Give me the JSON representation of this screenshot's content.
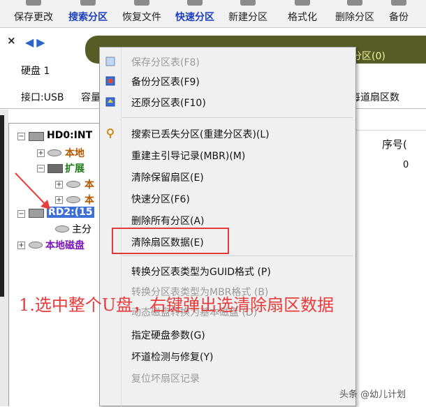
{
  "toolbar": {
    "items": [
      {
        "label": "保存更改",
        "icon": "save-icon"
      },
      {
        "label": "搜索分区",
        "icon": "search-partition-icon"
      },
      {
        "label": "恢复文件",
        "icon": "recover-file-icon"
      },
      {
        "label": "快速分区",
        "icon": "quick-partition-icon"
      },
      {
        "label": "新建分区",
        "icon": "new-partition-icon"
      },
      {
        "label": "格式化",
        "icon": "format-icon"
      },
      {
        "label": "删除分区",
        "icon": "delete-partition-icon"
      },
      {
        "label": "备份",
        "icon": "backup-icon"
      }
    ]
  },
  "info": {
    "close": "×",
    "nav": "◀▶",
    "disk": "硬盘 1",
    "interface": "接口:USB",
    "capacity": "容量",
    "sector_label": "每道扇区数",
    "partition_banner": "主分区(0)"
  },
  "tree": {
    "items": [
      {
        "label": "HD0:INT",
        "color": "#111111"
      },
      {
        "label": "本地",
        "color": "#b35a00"
      },
      {
        "label": "扩展",
        "color": "#1d7a16"
      },
      {
        "label": "本",
        "color": "#b35a00"
      },
      {
        "label": "本",
        "color": "#b35a00"
      },
      {
        "label": "RD2:(15",
        "color": "#ffffff"
      },
      {
        "label": "主分",
        "color": "#111111"
      },
      {
        "label": "本地磁盘",
        "color": "#7a17b8"
      }
    ]
  },
  "right": {
    "seq_header": "序号(",
    "seq_value": "0"
  },
  "menu": {
    "items": [
      {
        "label": "保存分区表(F8)",
        "disabled": true
      },
      {
        "label": "备份分区表(F9)",
        "disabled": false
      },
      {
        "label": "还原分区表(F10)",
        "disabled": false
      },
      {
        "label": "搜索已丢失分区(重建分区表)(L)",
        "disabled": false
      },
      {
        "label": "重建主引导记录(MBR)(M)",
        "disabled": false
      },
      {
        "label": "清除保留扇区(E)",
        "disabled": false
      },
      {
        "label": "快速分区(F6)",
        "disabled": false
      },
      {
        "label": "删除所有分区(A)",
        "disabled": false
      },
      {
        "label": "清除扇区数据(E)",
        "disabled": false
      },
      {
        "label": "转换分区表类型为GUID格式 (P)",
        "disabled": false
      },
      {
        "label": "转换分区表类型为MBR格式 (B)",
        "disabled": true
      },
      {
        "label": "动态磁盘转换为基本磁盘 (D)",
        "disabled": true
      },
      {
        "label": "指定硬盘参数(G)",
        "disabled": false
      },
      {
        "label": "坏道检测与修复(Y)",
        "disabled": false
      },
      {
        "label": "复位坏扇区记录",
        "disabled": true
      }
    ]
  },
  "annotation": {
    "text": "1.选中整个U盘，右键弹出选清除扇区数据",
    "color": "#e83c3c"
  },
  "watermark": "头条 @幼儿计划"
}
